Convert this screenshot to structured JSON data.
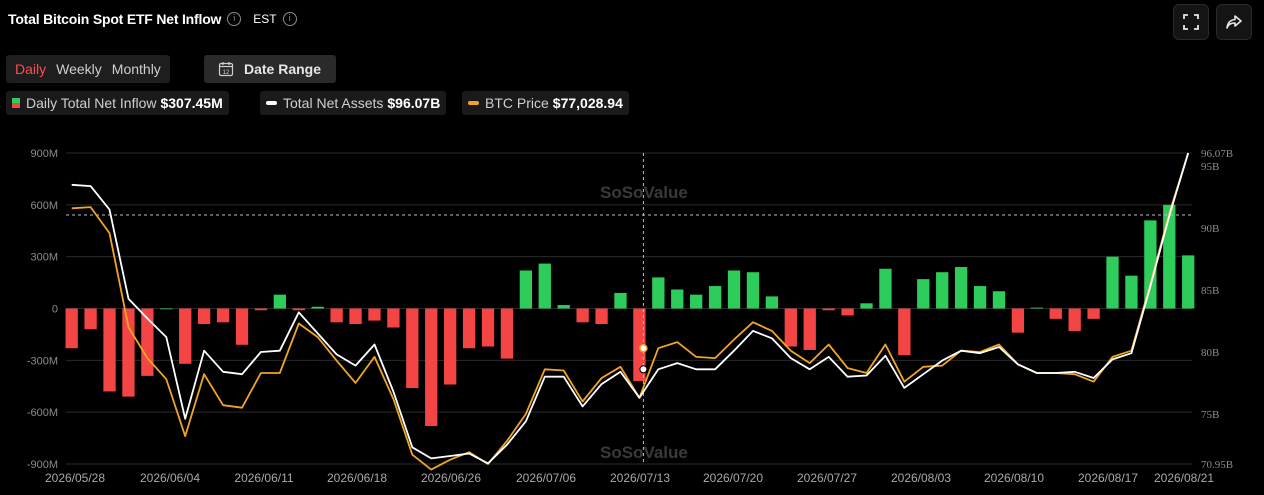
{
  "header": {
    "title": "Total Bitcoin Spot ETF Net Inflow",
    "timezone": "EST"
  },
  "tabs": [
    {
      "label": "Daily",
      "active": true
    },
    {
      "label": "Weekly",
      "active": false
    },
    {
      "label": "Monthly",
      "active": false
    }
  ],
  "date_range": {
    "label": "Date Range",
    "icon_text": "12"
  },
  "legend": [
    {
      "name": "Daily Total Net Inflow",
      "value": "$307.45M"
    },
    {
      "name": "Total Net Assets",
      "value": "$96.07B"
    },
    {
      "name": "BTC Price",
      "value": "$77,028.94"
    }
  ],
  "watermark": "SoSoValue",
  "colors": {
    "positive": "#2ecc5a",
    "negative": "#f44545",
    "assets_line": "#ffffff",
    "price_line": "#f0a526",
    "grid": "#2a2a2a",
    "tick": "#8c8c8c"
  },
  "chart_data": {
    "type": "bar",
    "title": "Total Bitcoin Spot ETF Net Inflow",
    "x_tick_labels": [
      "2026/05/28",
      "2026/06/04",
      "2026/06/11",
      "2026/06/18",
      "2026/06/26",
      "2026/07/06",
      "2026/07/13",
      "2026/07/20",
      "2026/07/27",
      "2026/08/03",
      "2026/08/10",
      "2026/08/17",
      "2026/08/21"
    ],
    "y_left": {
      "ticks": [
        "900M",
        "600M",
        "300M",
        "0",
        "-300M",
        "-600M",
        "-900M"
      ],
      "ylim": [
        -900,
        900
      ],
      "unit": "M"
    },
    "y_right": {
      "ticks": [
        "96.07B",
        "95B",
        "90B",
        "85B",
        "80B",
        "75B",
        "70.95B"
      ],
      "ylim": [
        70.95,
        96.07
      ],
      "unit": "B"
    },
    "series": [
      {
        "name": "Daily Total Net Inflow",
        "values": [
          -230,
          -120,
          -480,
          -510,
          -390,
          0,
          -320,
          -90,
          -80,
          -210,
          -10,
          80,
          -10,
          10,
          -80,
          -90,
          -70,
          -110,
          -460,
          -680,
          -440,
          -230,
          -220,
          -290,
          220,
          260,
          20,
          -80,
          -90,
          90,
          -420,
          180,
          110,
          80,
          130,
          220,
          210,
          70,
          -220,
          -240,
          -10,
          -40,
          30,
          230,
          -270,
          170,
          210,
          240,
          130,
          100,
          -140,
          5,
          -60,
          -130,
          -60,
          300,
          190,
          510,
          600,
          307.45
        ]
      },
      {
        "name": "Total Net Assets",
        "values": [
          93.5,
          93.4,
          91.5,
          84.3,
          82.7,
          81.2,
          74.6,
          80.1,
          78.4,
          78.2,
          80.0,
          80.1,
          83.2,
          81.5,
          79.8,
          78.9,
          80.6,
          76.8,
          72.3,
          71.4,
          71.6,
          71.8,
          71.0,
          72.5,
          74.4,
          78.0,
          78.0,
          75.6,
          77.4,
          78.4,
          76.3,
          78.6,
          79.1,
          78.6,
          78.6,
          80.1,
          81.7,
          81.1,
          79.5,
          78.6,
          79.6,
          78.0,
          78.1,
          79.7,
          77.1,
          78.2,
          79.3,
          80.1,
          79.9,
          80.4,
          79.0,
          78.3,
          78.3,
          78.4,
          77.9,
          79.4,
          79.9,
          85.3,
          91.0,
          96.07
        ]
      },
      {
        "name": "BTC Price",
        "values": [
          91.6,
          91.7,
          89.6,
          82.0,
          79.5,
          77.8,
          73.2,
          78.2,
          75.7,
          75.5,
          78.3,
          78.3,
          82.3,
          81.2,
          79.3,
          77.5,
          79.6,
          76.2,
          71.7,
          70.5,
          71.3,
          71.9,
          70.95,
          72.8,
          75.0,
          78.6,
          78.5,
          76.0,
          77.9,
          78.8,
          76.3,
          80.3,
          80.8,
          79.6,
          79.5,
          81.0,
          82.4,
          81.7,
          80.1,
          79.1,
          80.6,
          78.7,
          78.3,
          80.6,
          77.6,
          78.8,
          78.9,
          80.1,
          80.0,
          80.6,
          79.0,
          78.3,
          78.3,
          78.2,
          77.6,
          79.6,
          80.1,
          85.5,
          91.2,
          96.07
        ]
      }
    ],
    "x_labels_shown": [
      "2026/05/28",
      "2026/06/04",
      "2026/06/11",
      "2026/06/18",
      "2026/06/26",
      "2026/07/06",
      "2026/07/13",
      "2026/07/20",
      "2026/07/27",
      "2026/08/03",
      "2026/08/10",
      "2026/08/17",
      "2026/08/21"
    ]
  }
}
